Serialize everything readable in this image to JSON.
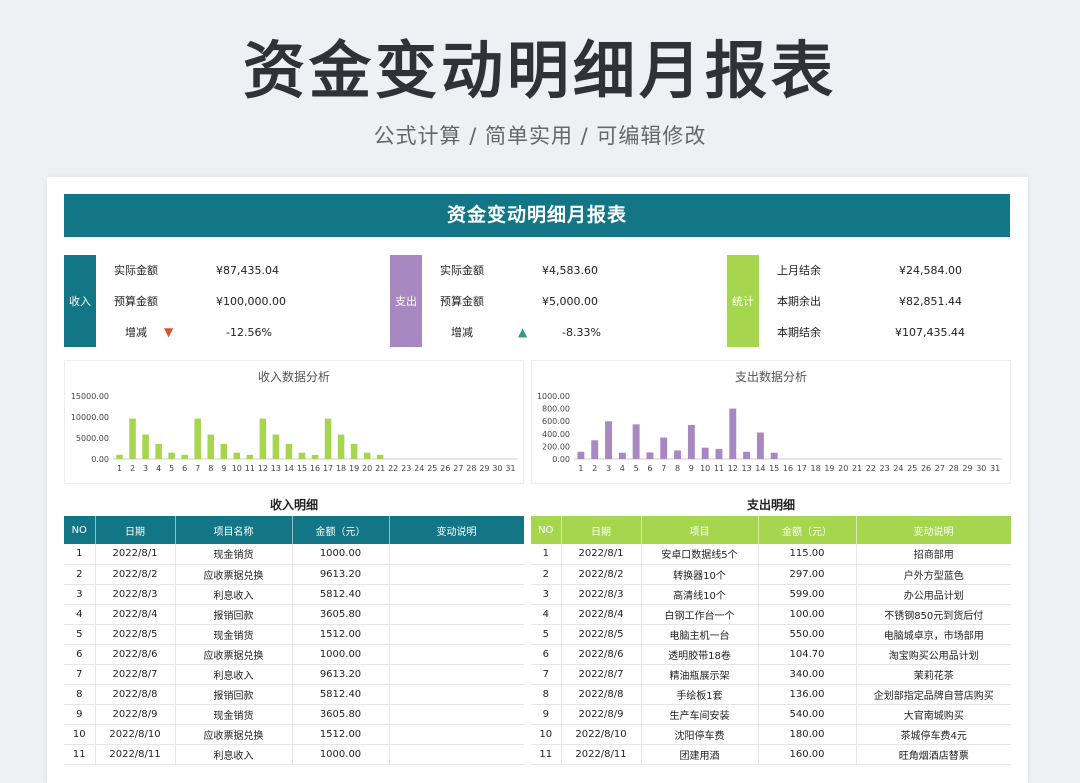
{
  "page": {
    "title": "资金变动明细月报表",
    "subtitle": "公式计算 / 简单实用 / 可编辑修改"
  },
  "report": {
    "title": "资金变动明细月报表"
  },
  "income": {
    "label": "收入",
    "actual_label": "实际金额",
    "actual": "¥87,435.04",
    "budget_label": "预算金额",
    "budget": "¥100,000.00",
    "change_label": "增减",
    "change": "-12.56%",
    "color": "#127686"
  },
  "expense": {
    "label": "支出",
    "actual_label": "实际金额",
    "actual": "¥4,583.60",
    "budget_label": "预算金额",
    "budget": "¥5,000.00",
    "change_label": "增减",
    "change": "-8.33%",
    "color": "#a888c0"
  },
  "stats": {
    "label": "统计",
    "prev_label": "上月结余",
    "prev": "¥24,584.00",
    "out_label": "本期余出",
    "out": "¥82,851.44",
    "end_label": "本期结余",
    "end": "¥107,435.44",
    "color": "#a6d64e"
  },
  "chart_data": [
    {
      "type": "bar",
      "title": "收入数据分析",
      "color": "#a6d64e",
      "categories": [
        "1",
        "2",
        "3",
        "4",
        "5",
        "6",
        "7",
        "8",
        "9",
        "10",
        "11",
        "12",
        "13",
        "14",
        "15",
        "16",
        "17",
        "18",
        "19",
        "20",
        "21",
        "22",
        "23",
        "24",
        "25",
        "26",
        "27",
        "28",
        "29",
        "30",
        "31"
      ],
      "values": [
        1000,
        9613.2,
        5812.4,
        3605.8,
        1512,
        1000,
        9613.2,
        5812.4,
        3605.8,
        1512,
        1000,
        9613.2,
        5812.4,
        3605.8,
        1512,
        1000,
        9613.2,
        5812.4,
        3605.8,
        1512,
        1000,
        0,
        0,
        0,
        0,
        0,
        0,
        0,
        0,
        0,
        0
      ],
      "yticks": [
        "15000.00",
        "10000.00",
        "5000.00",
        "0.00"
      ],
      "ylim": [
        0,
        15000
      ]
    },
    {
      "type": "bar",
      "title": "支出数据分析",
      "color": "#a888c0",
      "categories": [
        "1",
        "2",
        "3",
        "4",
        "5",
        "6",
        "7",
        "8",
        "9",
        "10",
        "11",
        "12",
        "13",
        "14",
        "15",
        "16",
        "17",
        "18",
        "19",
        "20",
        "21",
        "22",
        "23",
        "24",
        "25",
        "26",
        "27",
        "28",
        "29",
        "30",
        "31"
      ],
      "values": [
        115,
        297,
        599,
        100,
        550,
        104.7,
        340,
        136,
        540,
        180,
        160,
        800,
        115,
        420,
        100,
        0,
        0,
        0,
        0,
        0,
        0,
        0,
        0,
        0,
        0,
        0,
        0,
        0,
        0,
        0,
        0
      ],
      "yticks": [
        "1000.00",
        "800.00",
        "600.00",
        "400.00",
        "200.00",
        "0.00"
      ],
      "ylim": [
        0,
        1000
      ]
    }
  ],
  "income_detail": {
    "title": "收入明细",
    "headers": [
      "NO",
      "日期",
      "项目名称",
      "金额（元）",
      "变动说明"
    ],
    "rows": [
      [
        "1",
        "2022/8/1",
        "现金销货",
        "1000.00",
        ""
      ],
      [
        "2",
        "2022/8/2",
        "应收票据兑换",
        "9613.20",
        ""
      ],
      [
        "3",
        "2022/8/3",
        "利息收入",
        "5812.40",
        ""
      ],
      [
        "4",
        "2022/8/4",
        "报销回款",
        "3605.80",
        ""
      ],
      [
        "5",
        "2022/8/5",
        "现金销货",
        "1512.00",
        ""
      ],
      [
        "6",
        "2022/8/6",
        "应收票据兑换",
        "1000.00",
        ""
      ],
      [
        "7",
        "2022/8/7",
        "利息收入",
        "9613.20",
        ""
      ],
      [
        "8",
        "2022/8/8",
        "报销回款",
        "5812.40",
        ""
      ],
      [
        "9",
        "2022/8/9",
        "现金销货",
        "3605.80",
        ""
      ],
      [
        "10",
        "2022/8/10",
        "应收票据兑换",
        "1512.00",
        ""
      ],
      [
        "11",
        "2022/8/11",
        "利息收入",
        "1000.00",
        ""
      ]
    ]
  },
  "expense_detail": {
    "title": "支出明细",
    "headers": [
      "NO",
      "日期",
      "项目",
      "金额（元）",
      "变动说明"
    ],
    "rows": [
      [
        "1",
        "2022/8/1",
        "安卓口数据线5个",
        "115.00",
        "招商部用"
      ],
      [
        "2",
        "2022/8/2",
        "转换器10个",
        "297.00",
        "户外方型蓝色"
      ],
      [
        "3",
        "2022/8/3",
        "高清线10个",
        "599.00",
        "办公用品计划"
      ],
      [
        "4",
        "2022/8/4",
        "白钢工作台一个",
        "100.00",
        "不锈钢850元到货后付"
      ],
      [
        "5",
        "2022/8/5",
        "电脑主机一台",
        "550.00",
        "电脑城卓京，市场部用"
      ],
      [
        "6",
        "2022/8/6",
        "透明胶带18卷",
        "104.70",
        "淘宝购买公用品计划"
      ],
      [
        "7",
        "2022/8/7",
        "精油瓶展示架",
        "340.00",
        "茉莉花茶"
      ],
      [
        "8",
        "2022/8/8",
        "手绘板1套",
        "136.00",
        "企划部指定品牌自营店购买"
      ],
      [
        "9",
        "2022/8/9",
        "生产车间安装",
        "540.00",
        "大官南城购买"
      ],
      [
        "10",
        "2022/8/10",
        "沈阳停车费",
        "180.00",
        "茶城停车费4元"
      ],
      [
        "11",
        "2022/8/11",
        "团建用酒",
        "160.00",
        "旺角烟酒店替票"
      ]
    ]
  }
}
